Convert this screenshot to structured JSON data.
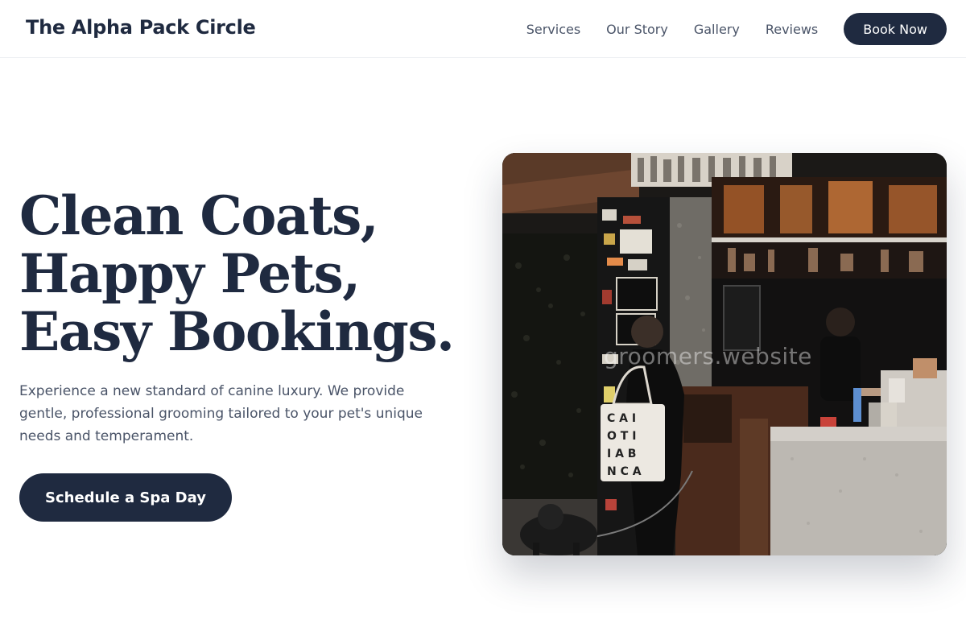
{
  "header": {
    "brand": "The Alpha Pack Circle",
    "nav": [
      "Services",
      "Our Story",
      "Gallery",
      "Reviews"
    ],
    "book_label": "Book Now"
  },
  "hero": {
    "headline_lines": [
      "Clean Coats,",
      "Happy Pets,",
      "Easy Bookings."
    ],
    "subtext": "Experience a new standard of canine luxury. We provide gentle, professional grooming tailored to your pet's unique needs and temperament.",
    "cta_label": "Schedule a Spa Day",
    "image_watermark": "groomers.website",
    "tote_letters": [
      "C A I",
      "O T I",
      "I A B",
      "N C A"
    ]
  },
  "colors": {
    "primary": "#1f2a40",
    "text_muted": "#4a5468",
    "background": "#ffffff"
  }
}
